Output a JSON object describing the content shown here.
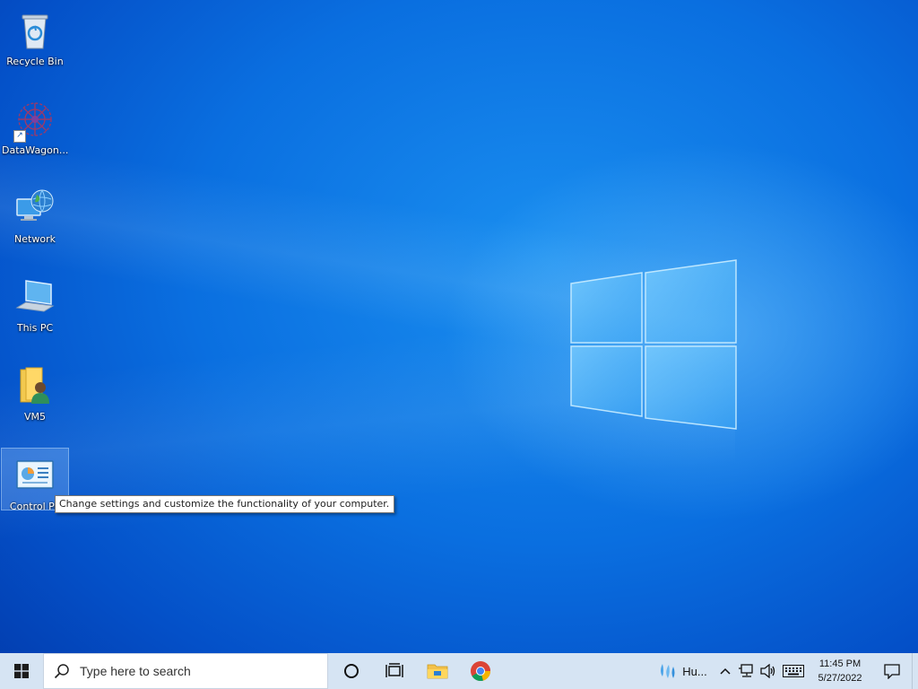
{
  "desktop": {
    "icons": [
      {
        "label": "Recycle Bin",
        "icon": "recycle-bin-icon"
      },
      {
        "label": "DataWagon...",
        "icon": "datawagon-app-icon",
        "shortcut": true
      },
      {
        "label": "Network",
        "icon": "network-icon"
      },
      {
        "label": "This PC",
        "icon": "this-pc-icon"
      },
      {
        "label": "VM5",
        "icon": "user-folder-icon"
      },
      {
        "label": "Control Pa",
        "icon": "control-panel-icon",
        "selected": true
      }
    ],
    "tooltip": "Change settings and customize the functionality of your computer.",
    "wallpaper_colors": {
      "deep": "#0238a8",
      "mid": "#0a6fe0",
      "light": "#1a8ff0",
      "logo": "#8fd4ff"
    }
  },
  "taskbar": {
    "background": "#d6e4f3",
    "start_icon": "windows-start-icon",
    "search_placeholder": "Type here to search",
    "pinned": [
      {
        "name": "cortana",
        "icon": "cortana-circle-icon"
      },
      {
        "name": "task-view",
        "icon": "task-view-icon"
      },
      {
        "name": "file-explorer",
        "icon": "folder-icon"
      },
      {
        "name": "chrome",
        "icon": "chrome-icon"
      }
    ],
    "tray": {
      "weather_label": "Hu...",
      "weather_icon": "weather-humidity-icon",
      "chevron_icon": "chevron-up-icon",
      "network_icon": "network-wired-icon",
      "volume_icon": "volume-icon",
      "keyboard_icon": "keyboard-icon",
      "time": "11:45 PM",
      "date": "5/27/2022",
      "notification_icon": "notification-icon"
    }
  }
}
